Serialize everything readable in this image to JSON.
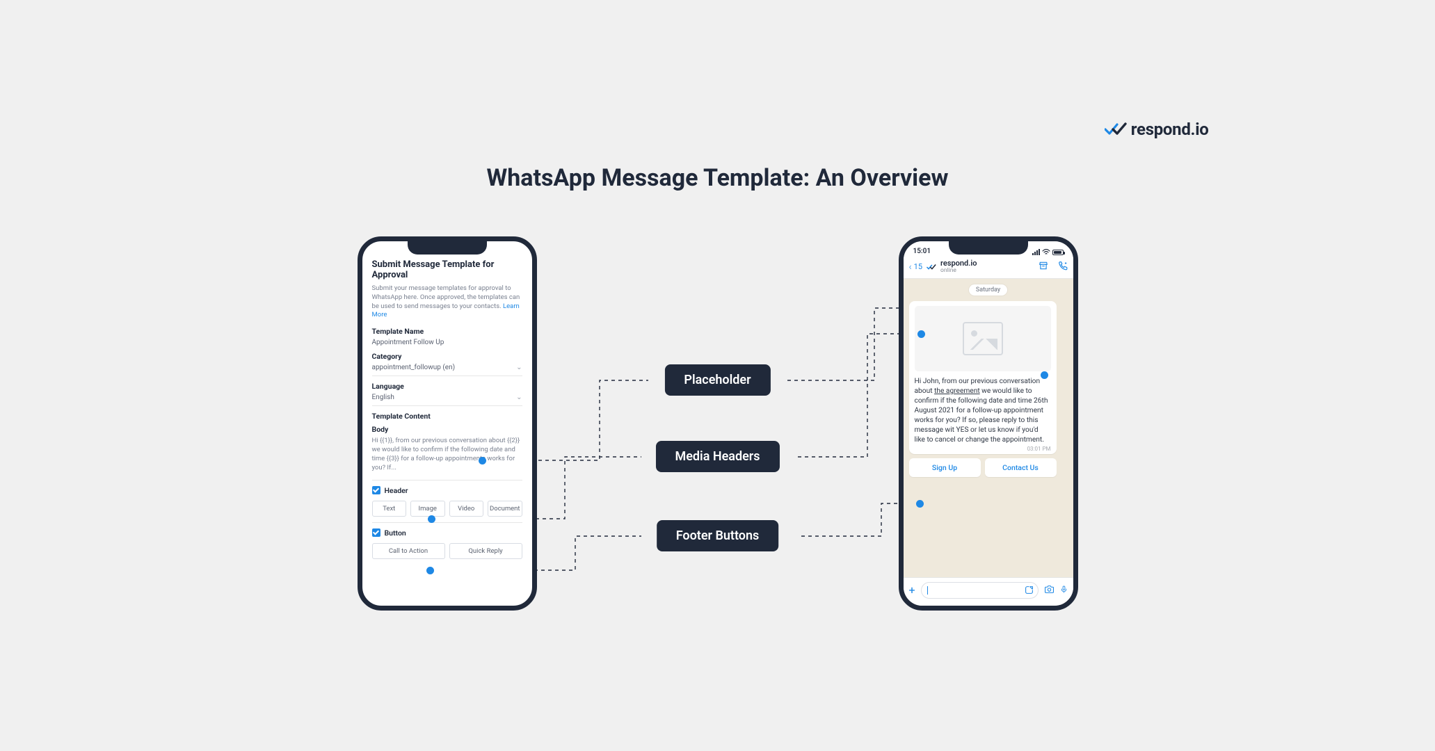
{
  "brand": {
    "name": "respond.io"
  },
  "title": "WhatsApp Message Template: An Overview",
  "pills": {
    "placeholder": "Placeholder",
    "media_headers": "Media Headers",
    "footer_buttons": "Footer Buttons"
  },
  "left_form": {
    "heading": "Submit Message Template for Approval",
    "description": "Submit your message templates for approval to WhatsApp here. Once approved, the templates can be used to send messages to your contacts.",
    "learn_more": "Learn More",
    "template_name_label": "Template Name",
    "template_name_value": "Appointment Follow Up",
    "category_label": "Category",
    "category_value": "appointment_followup (en)",
    "language_label": "Language",
    "language_value": "English",
    "content_label": "Template Content",
    "body_label": "Body",
    "body_text": "Hi {{1}}, from our previous conversation about {{2}} we would like to confirm if the following date and time {{3}} for a follow-up appointments works for you? If...",
    "header_label": "Header",
    "header_options": [
      "Text",
      "Image",
      "Video",
      "Document"
    ],
    "button_label": "Button",
    "button_options": [
      "Call to Action",
      "Quick Reply"
    ]
  },
  "right_chat": {
    "status_time": "15:01",
    "back_count": "15",
    "contact_name": "respond.io",
    "contact_status": "online",
    "day_label": "Saturday",
    "message_text_pre": "Hi John, from our previous conversation about ",
    "message_text_underlined": "the agreement",
    "message_text_post": " we would like to confirm if the following date and time 26th August 2021 for a follow-up appointment works for you? If so, please reply to this message wit YES or let us know if you'd like to cancel or change the appointment.",
    "message_time": "03:01 PM",
    "buttons": [
      "Sign Up",
      "Contact Us"
    ]
  }
}
